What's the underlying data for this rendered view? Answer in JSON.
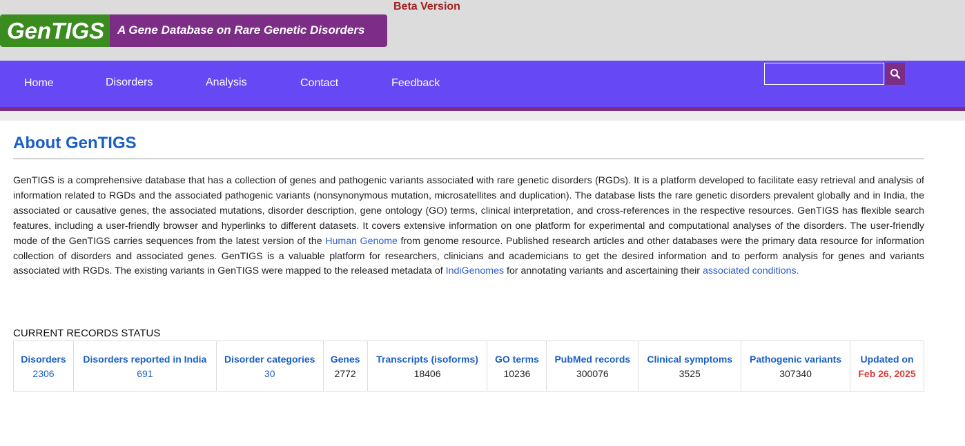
{
  "header": {
    "logo_name": "GenTIGS",
    "logo_tagline": "A Gene Database on Rare Genetic Disorders",
    "beta_label": "Beta Version",
    "colors": {
      "logo_green": "#3a8c1e",
      "logo_purple": "#7c2d86",
      "nav_bg": "#6648f5",
      "title_blue": "#1a5fc4"
    }
  },
  "nav": {
    "items": [
      "Home",
      "Disorders",
      "Analysis",
      "Contact",
      "Feedback"
    ],
    "search": {
      "placeholder": "",
      "value": "",
      "icon": "search-icon"
    }
  },
  "main": {
    "title": "About GenTIGS",
    "para": {
      "t1": "GenTIGS is a comprehensive database that has a collection of genes and pathogenic variants associated with rare genetic disorders (RGDs). It is a platform developed to facilitate easy retrieval and analysis of information related to RGDs and the associated pathogenic variants (nonsynonymous mutation, microsatellites and duplication). The database lists the rare genetic disorders prevalent globally and in India, the associated or causative genes, the associated mutations, disorder description, gene ontology (GO) terms, clinical interpretation, and cross-references in the respective resources. GenTIGS has flexible search features, including a user-friendly browser and hyperlinks to different datasets. It covers extensive information on one platform for experimental and computational analyses of the disorders. The user-friendly mode of the GenTIGS carries sequences from the latest version of the ",
      "link1": "Human Genome",
      "t2": " from genome resource. Published research articles and other databases were the primary data resource for information collection of disorders and associated genes. GenTIGS is a valuable platform for researchers, clinicians and academicians to get the desired information and to perform analysis for genes and variants associated with RGDs. The existing variants in GenTIGS were mapped to the released metadata of ",
      "link2": "IndiGenomes",
      "t3": " for annotating variants and ascertaining their ",
      "link3": "associated conditions."
    }
  },
  "records": {
    "label": "CURRENT RECORDS STATUS",
    "columns": [
      {
        "header": "Disorders",
        "value": "2306"
      },
      {
        "header": "Disorders reported in India",
        "value": "691"
      },
      {
        "header": "Disorder categories",
        "value": "30"
      },
      {
        "header": "Genes",
        "value": "2772"
      },
      {
        "header": "Transcripts (isoforms)",
        "value": "18406"
      },
      {
        "header": "GO terms",
        "value": "10236"
      },
      {
        "header": "PubMed records",
        "value": "300076"
      },
      {
        "header": "Clinical symptoms",
        "value": "3525"
      },
      {
        "header": "Pathogenic variants",
        "value": "307340"
      },
      {
        "header": "Updated on",
        "value": "Feb 26, 2025"
      }
    ]
  }
}
